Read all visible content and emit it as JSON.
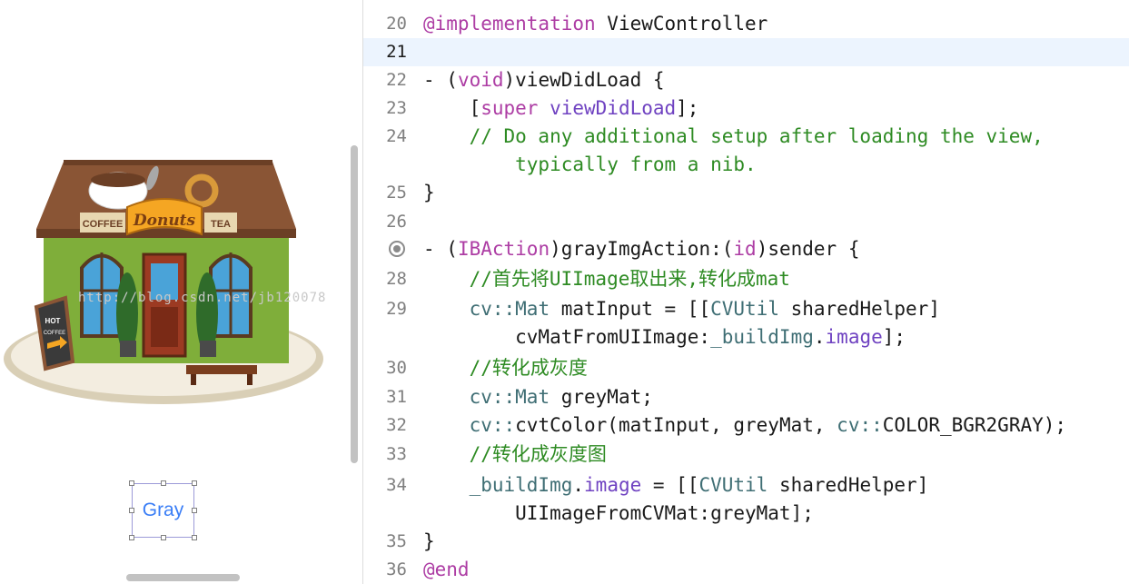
{
  "canvas": {
    "image_name": "donuts-coffee-shop-image",
    "shop_signs": {
      "left": "COFFEE",
      "center": "Donuts",
      "right": "TEA",
      "board_line1": "HOT",
      "board_line2": "COFFEE"
    },
    "button_label": "Gray"
  },
  "editor": {
    "watermark": "http://blog.csdn.net/jb120078",
    "lines": [
      {
        "num": "20",
        "segs": [
          {
            "t": "@implementation",
            "c": "kw"
          },
          {
            "t": " ViewController",
            "c": ""
          }
        ]
      },
      {
        "num": "21",
        "segs": []
      },
      {
        "num": "22",
        "segs": [
          {
            "t": "- (",
            "c": ""
          },
          {
            "t": "void",
            "c": "kw"
          },
          {
            "t": ")viewDidLoad {",
            "c": ""
          }
        ]
      },
      {
        "num": "23",
        "segs": [
          {
            "t": "    [",
            "c": ""
          },
          {
            "t": "super",
            "c": "kw"
          },
          {
            "t": " viewDidLoad",
            "c": "mem"
          },
          {
            "t": "];",
            "c": ""
          }
        ]
      },
      {
        "num": "24",
        "segs": [
          {
            "t": "    // Do any additional setup after loading the view,",
            "c": "cm"
          }
        ]
      },
      {
        "num": "",
        "segs": [
          {
            "t": "        typically from a nib.",
            "c": "cm"
          }
        ]
      },
      {
        "num": "25",
        "segs": [
          {
            "t": "}",
            "c": ""
          }
        ]
      },
      {
        "num": "26",
        "segs": []
      },
      {
        "num": "",
        "segs": [
          {
            "t": "- (",
            "c": ""
          },
          {
            "t": "IBAction",
            "c": "kw"
          },
          {
            "t": ")grayImgAction:(",
            "c": ""
          },
          {
            "t": "id",
            "c": "kw"
          },
          {
            "t": ")sender {",
            "c": ""
          }
        ]
      },
      {
        "num": "28",
        "segs": [
          {
            "t": "    //首先将UIImage取出来,转化成mat",
            "c": "cm"
          }
        ]
      },
      {
        "num": "29",
        "segs": [
          {
            "t": "    cv::",
            "c": "cls"
          },
          {
            "t": "Mat",
            "c": "cls"
          },
          {
            "t": " matInput = [[",
            "c": ""
          },
          {
            "t": "CVUtil",
            "c": "cls"
          },
          {
            "t": " sharedHelper]",
            "c": ""
          }
        ]
      },
      {
        "num": "",
        "segs": [
          {
            "t": "        cvMatFromUIImage:",
            "c": ""
          },
          {
            "t": "_buildImg",
            "c": "ivar"
          },
          {
            "t": ".",
            "c": ""
          },
          {
            "t": "image",
            "c": "mem"
          },
          {
            "t": "];",
            "c": ""
          }
        ]
      },
      {
        "num": "30",
        "segs": [
          {
            "t": "    //转化成灰度",
            "c": "cm"
          }
        ]
      },
      {
        "num": "31",
        "segs": [
          {
            "t": "    cv::",
            "c": "cls"
          },
          {
            "t": "Mat",
            "c": "cls"
          },
          {
            "t": " greyMat;",
            "c": ""
          }
        ]
      },
      {
        "num": "32",
        "segs": [
          {
            "t": "    cv::",
            "c": "cls"
          },
          {
            "t": "cvtColor(matInput, greyMat, ",
            "c": ""
          },
          {
            "t": "cv::",
            "c": "cls"
          },
          {
            "t": "COLOR_BGR2GRAY);",
            "c": ""
          }
        ]
      },
      {
        "num": "33",
        "segs": [
          {
            "t": "    //转化成灰度图",
            "c": "cm"
          }
        ]
      },
      {
        "num": "34",
        "segs": [
          {
            "t": "    _buildImg",
            "c": "ivar"
          },
          {
            "t": ".",
            "c": ""
          },
          {
            "t": "image",
            "c": "mem"
          },
          {
            "t": " = [[",
            "c": ""
          },
          {
            "t": "CVUtil",
            "c": "cls"
          },
          {
            "t": " sharedHelper]",
            "c": ""
          }
        ]
      },
      {
        "num": "",
        "segs": [
          {
            "t": "        UIImageFromCVMat:greyMat];",
            "c": ""
          }
        ]
      },
      {
        "num": "35",
        "segs": [
          {
            "t": "}",
            "c": ""
          }
        ]
      },
      {
        "num": "36",
        "segs": [
          {
            "t": "@end",
            "c": "kw"
          }
        ]
      }
    ]
  }
}
